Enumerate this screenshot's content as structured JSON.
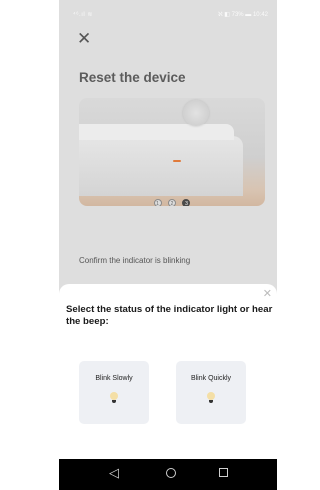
{
  "status_bar": {
    "left": "⁴⁶.ıl ≋",
    "right": "ℵ ◧ 73% ▬ 10:42"
  },
  "header": {
    "close_icon": "close-icon",
    "title": "Reset the device"
  },
  "illustration": {
    "steps": [
      "1",
      "2",
      "3"
    ],
    "current_step": 3
  },
  "confirm_text": "Confirm the indicator is blinking",
  "sheet": {
    "close_icon": "close-icon",
    "title": "Select the status of the indicator light or hear the beep:",
    "options": [
      {
        "label": "Blink Slowly",
        "icon": "bulb-icon"
      },
      {
        "label": "Blink Quickly",
        "icon": "bulb-icon"
      }
    ]
  },
  "nav": {
    "back": "◁",
    "home": "home-icon",
    "recents": "recents-icon"
  },
  "colors": {
    "bulb": "#f4dfa6",
    "led": "#e07a3a",
    "card_bg": "#eef0f4",
    "navbar": "#000000"
  }
}
